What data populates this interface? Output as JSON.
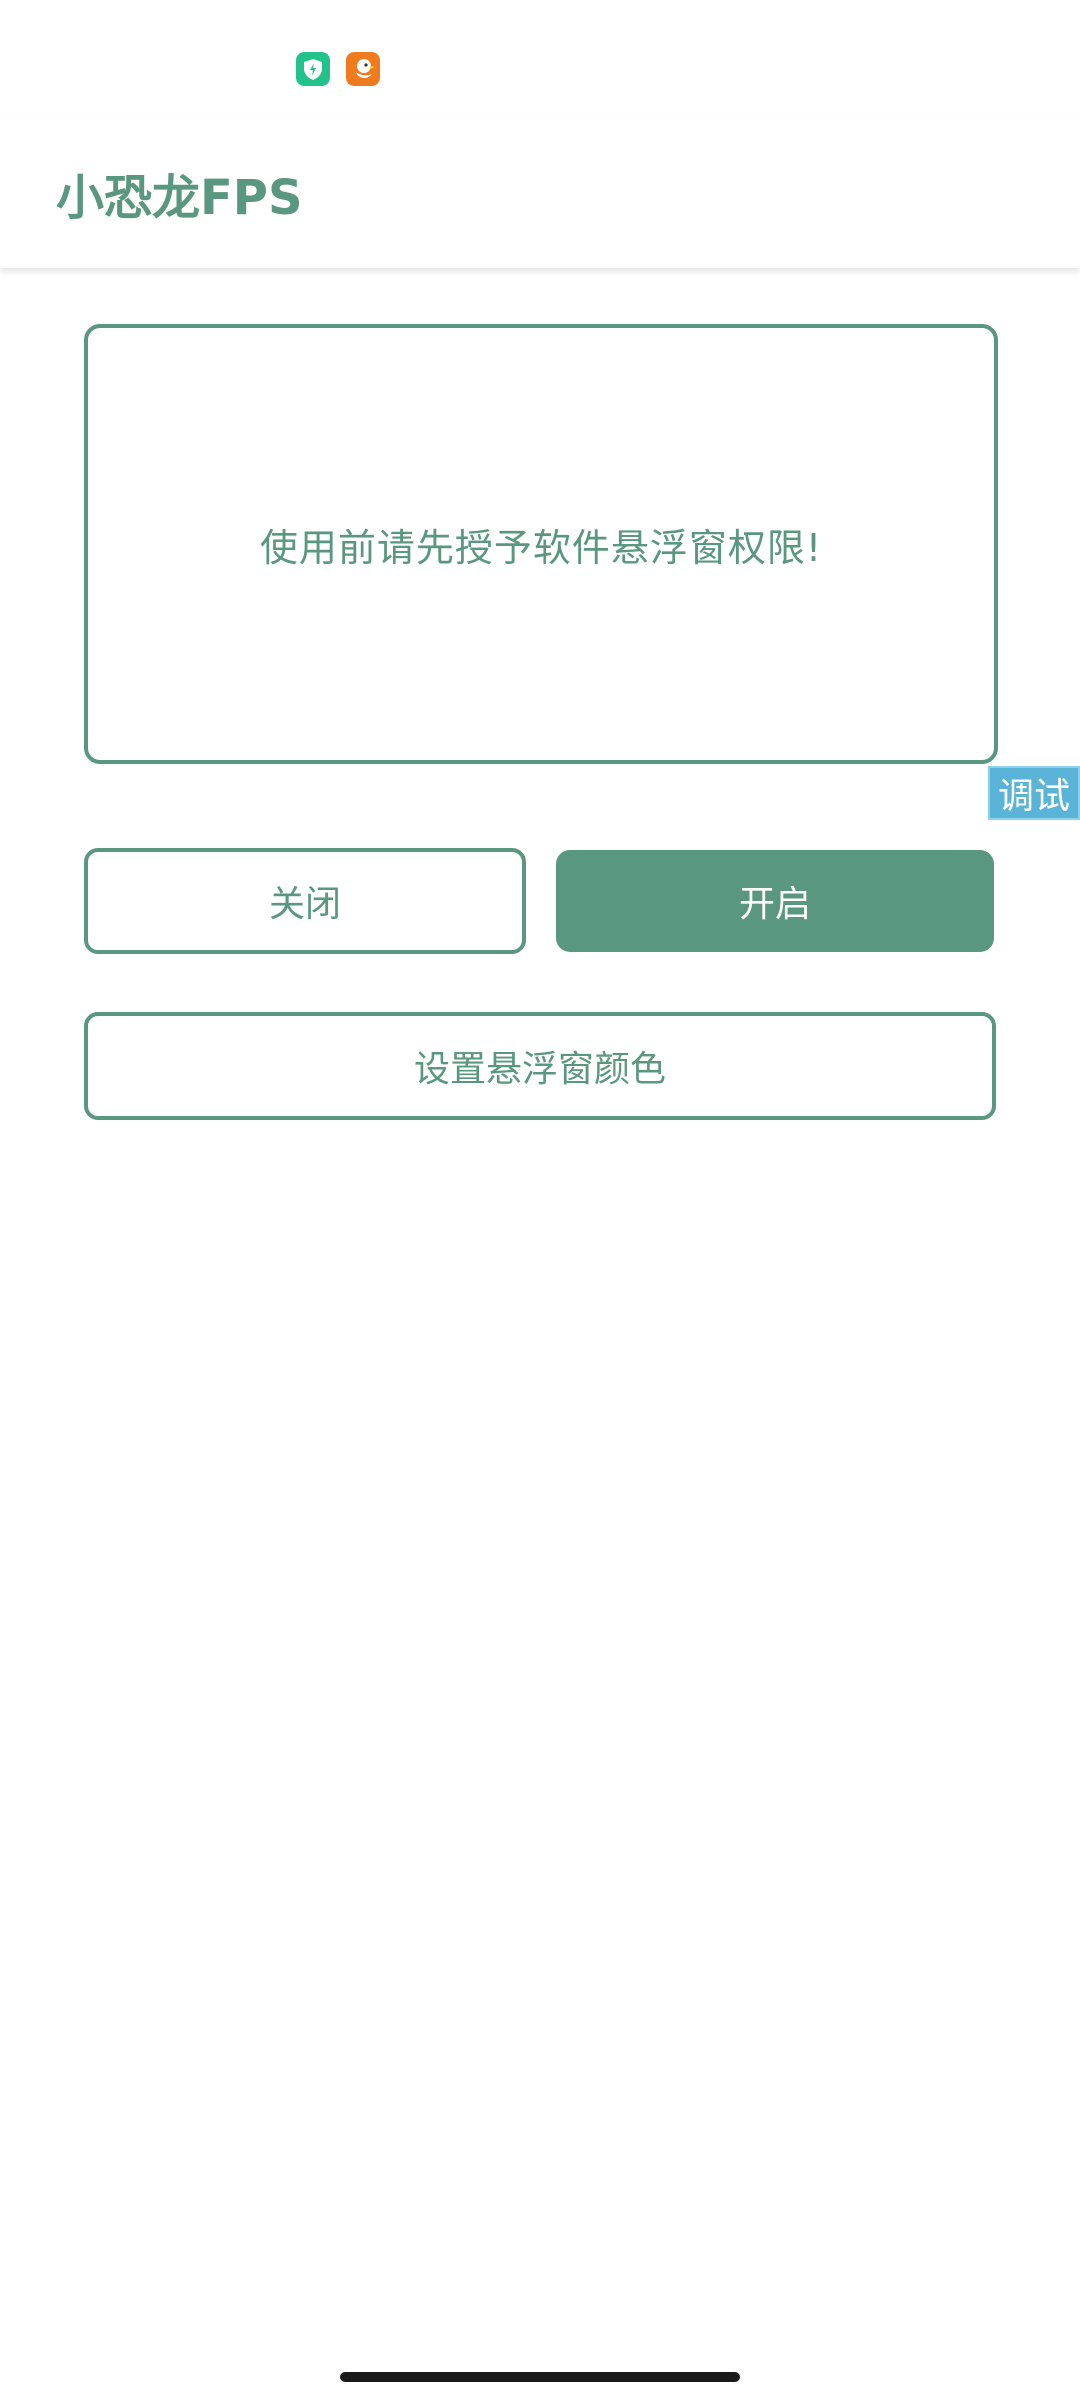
{
  "status_bar": {
    "icons": [
      "shield-app-icon",
      "duck-app-icon"
    ]
  },
  "app_bar": {
    "title": "小恐龙FPS"
  },
  "notice": {
    "text": "使用前请先授予软件悬浮窗权限!"
  },
  "debug_tag": {
    "label": "调试"
  },
  "buttons": {
    "close_label": "关闭",
    "open_label": "开启",
    "set_color_label": "设置悬浮窗颜色"
  },
  "colors": {
    "accent": "#5a9780",
    "debug_tag": "#5ab4d8",
    "background": "#ffffff"
  }
}
